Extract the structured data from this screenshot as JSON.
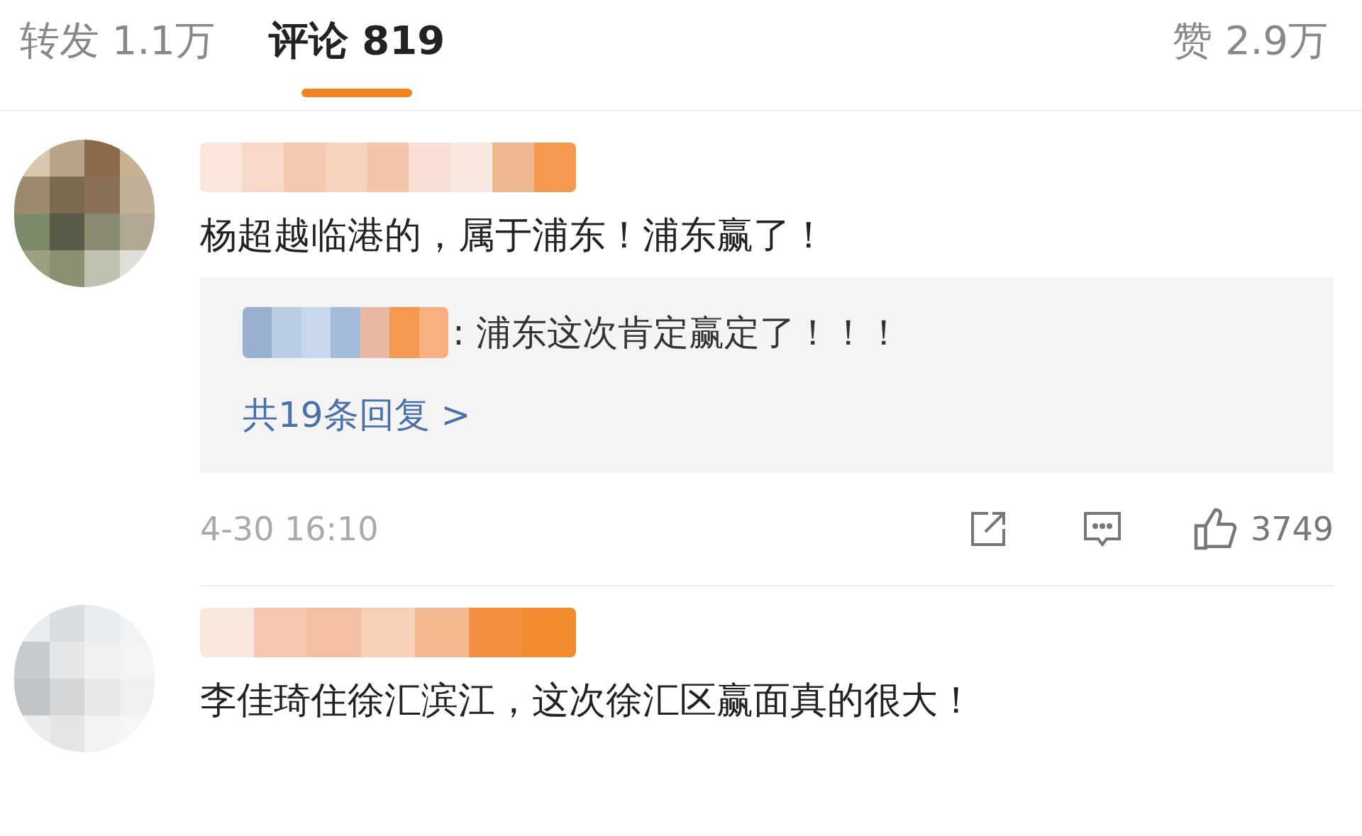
{
  "tabs": [
    {
      "label": "转发",
      "count": "1.1万",
      "selected": false
    },
    {
      "label": "评论",
      "count": "819",
      "selected": true
    }
  ],
  "likes_tab": {
    "label": "赞",
    "count": "2.9万"
  },
  "comments": [
    {
      "text": "杨超越临港的，属于浦东！浦东赢了！",
      "reply": {
        "text": ": 浦东这次肯定赢定了！！！",
        "more": "共19条回复 >"
      },
      "time": "4-30 16:10",
      "likes": "3749"
    },
    {
      "text": "李佳琦住徐汇滨江，这次徐汇区赢面真的很大！"
    }
  ]
}
